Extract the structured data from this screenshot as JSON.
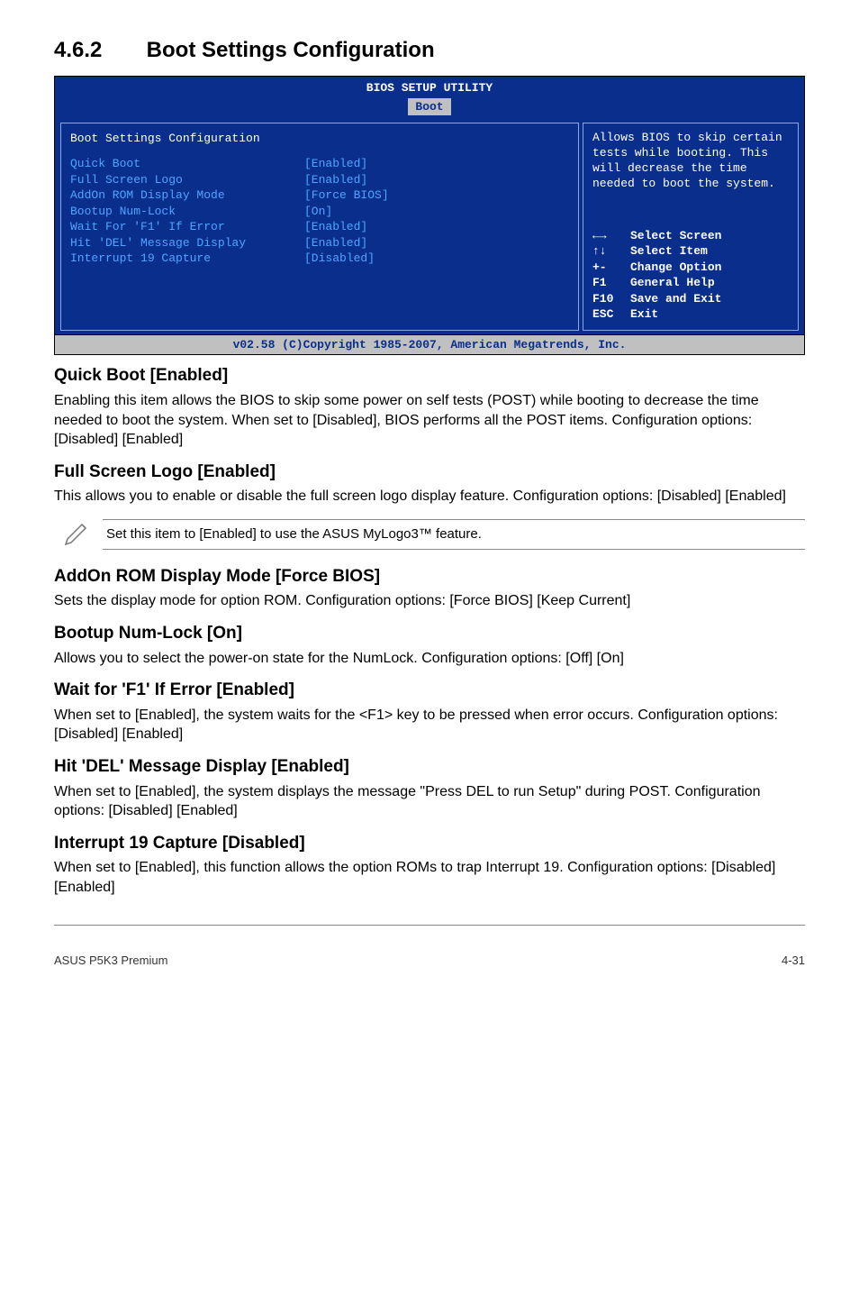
{
  "section": {
    "number": "4.6.2",
    "title": "Boot Settings Configuration"
  },
  "bios": {
    "title": "BIOS SETUP UTILITY",
    "active_tab": "Boot",
    "panel_heading": "Boot Settings Configuration",
    "items": [
      {
        "label": "Quick Boot",
        "value": "[Enabled]"
      },
      {
        "label": "Full Screen Logo",
        "value": "[Enabled]"
      },
      {
        "label": "AddOn ROM Display Mode",
        "value": "[Force BIOS]"
      },
      {
        "label": "Bootup Num-Lock",
        "value": "[On]"
      },
      {
        "label": "Wait For 'F1' If Error",
        "value": "[Enabled]"
      },
      {
        "label": "Hit 'DEL' Message Display",
        "value": "[Enabled]"
      },
      {
        "label": "Interrupt 19 Capture",
        "value": "[Disabled]"
      }
    ],
    "help_top": "Allows BIOS to skip certain tests while booting. This will decrease the time needed to boot the system.",
    "keys": [
      {
        "k": "←→",
        "d": "Select Screen"
      },
      {
        "k": "↑↓",
        "d": "Select Item"
      },
      {
        "k": "+-",
        "d": "Change Option"
      },
      {
        "k": "F1",
        "d": "General Help"
      },
      {
        "k": "F10",
        "d": "Save and Exit"
      },
      {
        "k": "ESC",
        "d": "Exit"
      }
    ],
    "footer": "v02.58 (C)Copyright 1985-2007, American Megatrends, Inc."
  },
  "subs": {
    "quickboot": {
      "h": "Quick Boot [Enabled]",
      "p": "Enabling this item allows the BIOS to skip some power on self tests (POST) while booting to decrease the time needed to boot the system. When set to [Disabled], BIOS performs all the POST items. Configuration options: [Disabled] [Enabled]"
    },
    "fullscreen": {
      "h": "Full Screen Logo [Enabled]",
      "p": "This allows you to enable or disable the full screen logo display feature. Configuration options: [Disabled] [Enabled]"
    },
    "note_mylogo": "Set this item to [Enabled] to use the ASUS MyLogo3™ feature.",
    "addon": {
      "h": "AddOn ROM Display Mode [Force BIOS]",
      "p": "Sets the display mode for option ROM. Configuration options: [Force BIOS] [Keep Current]"
    },
    "numlock": {
      "h": "Bootup Num-Lock [On]",
      "p": "Allows you to select the power-on state for the NumLock. Configuration options: [Off] [On]"
    },
    "waitf1": {
      "h": "Wait for 'F1' If Error [Enabled]",
      "p": "When set to [Enabled], the system waits for the <F1> key to be pressed when error occurs. Configuration options: [Disabled] [Enabled]"
    },
    "hitdel": {
      "h": "Hit 'DEL' Message Display [Enabled]",
      "p": "When set to [Enabled], the system displays the message \"Press DEL to run Setup\" during POST. Configuration options: [Disabled] [Enabled]"
    },
    "int19": {
      "h": "Interrupt 19 Capture [Disabled]",
      "p": "When set to [Enabled], this function allows the option ROMs to trap Interrupt 19. Configuration options: [Disabled] [Enabled]"
    }
  },
  "footer": {
    "left": "ASUS P5K3 Premium",
    "right": "4-31"
  }
}
